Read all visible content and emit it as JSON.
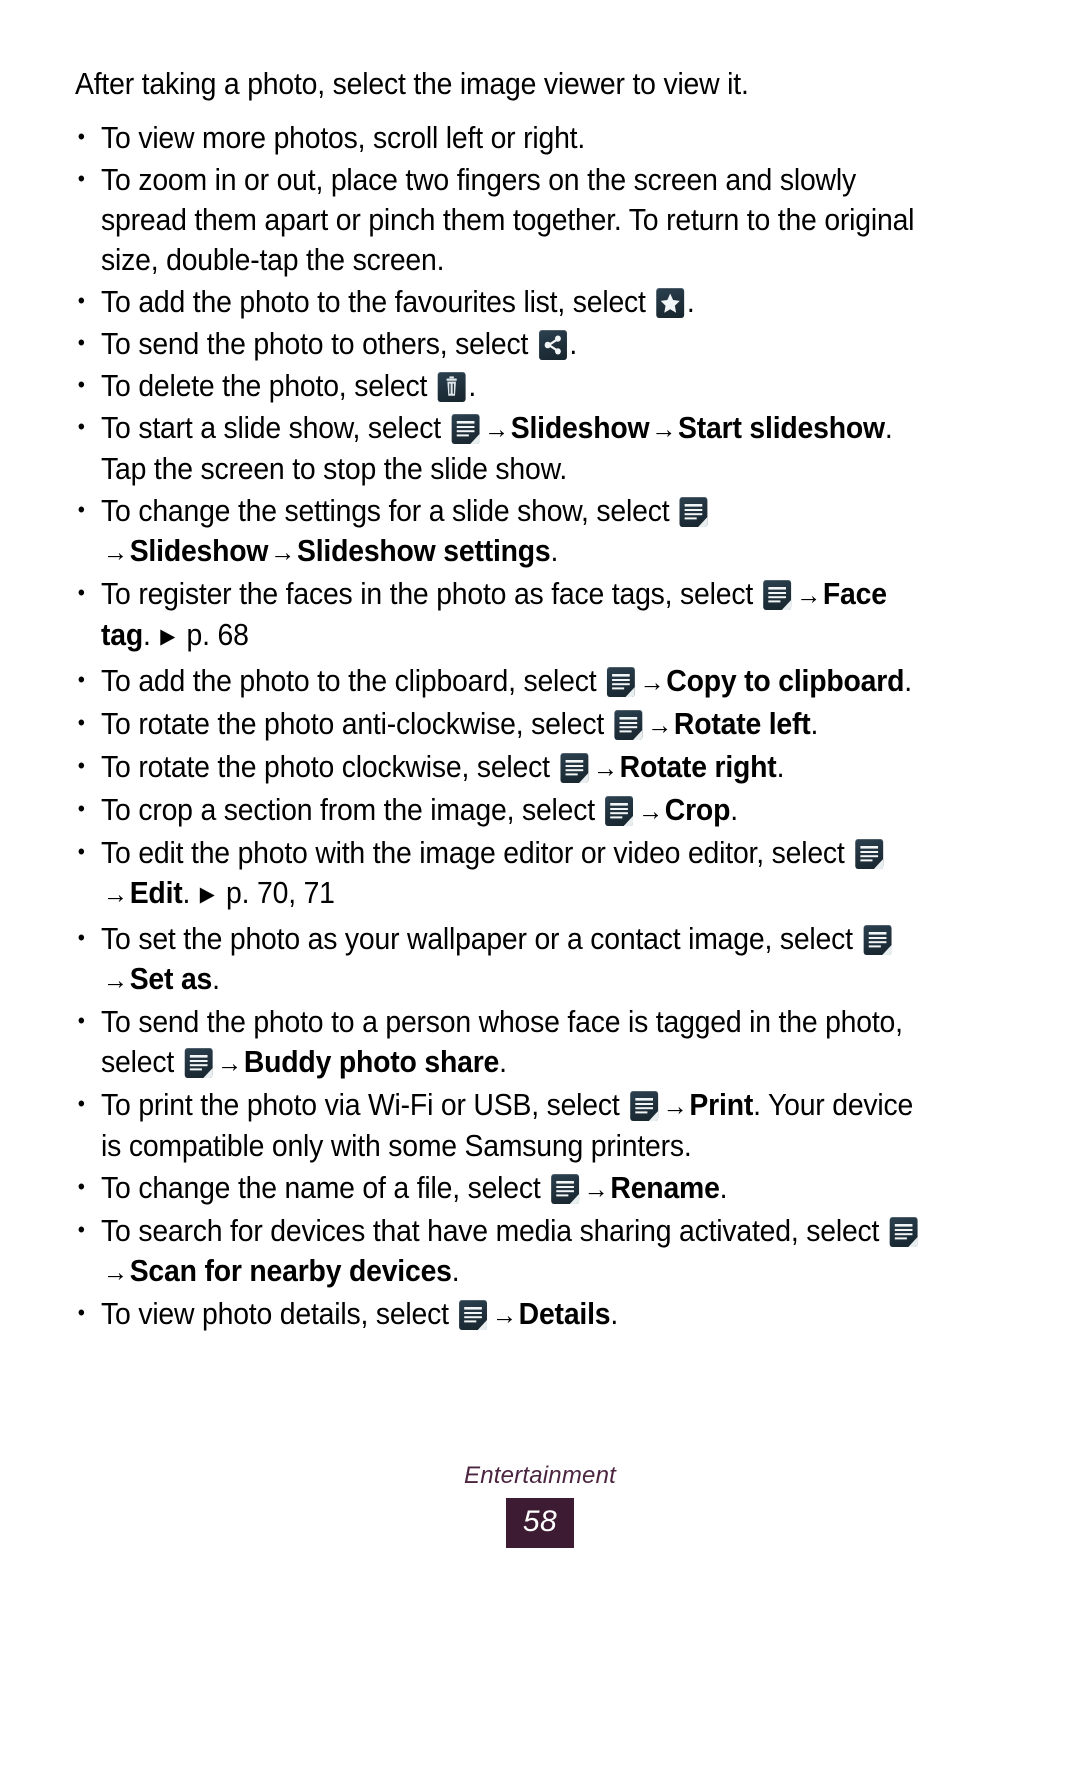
{
  "page": {
    "intro": "After taking a photo, select the image viewer to view it.",
    "footer_title": "Entertainment",
    "page_number": "58"
  },
  "icons": {
    "star": "star-icon",
    "share": "share-icon",
    "trash": "trash-icon",
    "menu": "menu-icon"
  },
  "symbols": {
    "arrow": "→",
    "pointer": "▶",
    "bullet": "•"
  },
  "bullets": [
    {
      "id": "scroll",
      "parts": [
        {
          "t": "text",
          "v": "To view more photos, scroll left or right."
        }
      ]
    },
    {
      "id": "zoom",
      "parts": [
        {
          "t": "text",
          "v": "To zoom in or out, place two fingers on the screen and slowly spread them apart or pinch them together. To return to the original size, double-tap the screen."
        }
      ]
    },
    {
      "id": "favourites",
      "parts": [
        {
          "t": "text",
          "v": "To add the photo to the favourites list, select "
        },
        {
          "t": "icon",
          "v": "star"
        },
        {
          "t": "text",
          "v": "."
        }
      ]
    },
    {
      "id": "send",
      "parts": [
        {
          "t": "text",
          "v": "To send the photo to others, select "
        },
        {
          "t": "icon",
          "v": "share"
        },
        {
          "t": "text",
          "v": "."
        }
      ]
    },
    {
      "id": "delete",
      "parts": [
        {
          "t": "text",
          "v": "To delete the photo, select "
        },
        {
          "t": "icon",
          "v": "trash"
        },
        {
          "t": "text",
          "v": "."
        }
      ]
    },
    {
      "id": "start-slideshow",
      "parts": [
        {
          "t": "text",
          "v": "To start a slide show, select "
        },
        {
          "t": "icon",
          "v": "menu"
        },
        {
          "t": "arrow"
        },
        {
          "t": "bold",
          "v": "Slideshow"
        },
        {
          "t": "arrow"
        },
        {
          "t": "bold",
          "v": "Start slideshow"
        },
        {
          "t": "text",
          "v": ". Tap the screen to stop the slide show."
        }
      ]
    },
    {
      "id": "slideshow-settings",
      "parts": [
        {
          "t": "text",
          "v": "To change the settings for a slide show, select "
        },
        {
          "t": "icon",
          "v": "menu"
        },
        {
          "t": "arrow"
        },
        {
          "t": "bold",
          "v": "Slideshow"
        },
        {
          "t": "arrow"
        },
        {
          "t": "bold",
          "v": "Slideshow settings"
        },
        {
          "t": "text",
          "v": "."
        }
      ]
    },
    {
      "id": "face-tag",
      "parts": [
        {
          "t": "text",
          "v": "To register the faces in the photo as face tags, select "
        },
        {
          "t": "icon",
          "v": "menu"
        },
        {
          "t": "arrow"
        },
        {
          "t": "bold",
          "v": "Face tag"
        },
        {
          "t": "text",
          "v": ". "
        },
        {
          "t": "pointer"
        },
        {
          "t": "text",
          "v": " p. 68"
        }
      ]
    },
    {
      "id": "copy-to-clipboard",
      "parts": [
        {
          "t": "text",
          "v": "To add the photo to the clipboard, select "
        },
        {
          "t": "icon",
          "v": "menu"
        },
        {
          "t": "arrow"
        },
        {
          "t": "bold",
          "v": "Copy to clipboard"
        },
        {
          "t": "text",
          "v": "."
        }
      ]
    },
    {
      "id": "rotate-left",
      "parts": [
        {
          "t": "text",
          "v": "To rotate the photo anti-clockwise, select "
        },
        {
          "t": "icon",
          "v": "menu"
        },
        {
          "t": "arrow"
        },
        {
          "t": "bold",
          "v": "Rotate left"
        },
        {
          "t": "text",
          "v": "."
        }
      ]
    },
    {
      "id": "rotate-right",
      "parts": [
        {
          "t": "text",
          "v": "To rotate the photo clockwise, select "
        },
        {
          "t": "icon",
          "v": "menu"
        },
        {
          "t": "arrow"
        },
        {
          "t": "bold",
          "v": "Rotate right"
        },
        {
          "t": "text",
          "v": "."
        }
      ]
    },
    {
      "id": "crop",
      "parts": [
        {
          "t": "text",
          "v": "To crop a section from the image, select "
        },
        {
          "t": "icon",
          "v": "menu"
        },
        {
          "t": "arrow"
        },
        {
          "t": "bold",
          "v": "Crop"
        },
        {
          "t": "text",
          "v": "."
        }
      ]
    },
    {
      "id": "edit",
      "parts": [
        {
          "t": "text",
          "v": "To edit the photo with the image editor or video editor, select "
        },
        {
          "t": "icon",
          "v": "menu"
        },
        {
          "t": "arrow"
        },
        {
          "t": "bold",
          "v": "Edit"
        },
        {
          "t": "text",
          "v": ". "
        },
        {
          "t": "pointer"
        },
        {
          "t": "text",
          "v": " p. 70, 71"
        }
      ]
    },
    {
      "id": "set-as",
      "parts": [
        {
          "t": "text",
          "v": "To set the photo as your wallpaper or a contact image, select "
        },
        {
          "t": "icon",
          "v": "menu"
        },
        {
          "t": "arrow"
        },
        {
          "t": "bold",
          "v": "Set as"
        },
        {
          "t": "text",
          "v": "."
        }
      ]
    },
    {
      "id": "buddy-photo-share",
      "parts": [
        {
          "t": "text",
          "v": "To send the photo to a person whose face is tagged in the photo, select "
        },
        {
          "t": "icon",
          "v": "menu"
        },
        {
          "t": "arrow"
        },
        {
          "t": "bold",
          "v": "Buddy photo share"
        },
        {
          "t": "text",
          "v": "."
        }
      ]
    },
    {
      "id": "print",
      "parts": [
        {
          "t": "text",
          "v": "To print the photo via Wi-Fi or USB, select "
        },
        {
          "t": "icon",
          "v": "menu"
        },
        {
          "t": "arrow"
        },
        {
          "t": "bold",
          "v": "Print"
        },
        {
          "t": "text",
          "v": ". Your device is compatible only with some Samsung printers."
        }
      ]
    },
    {
      "id": "rename",
      "parts": [
        {
          "t": "text",
          "v": "To change the name of a file, select "
        },
        {
          "t": "icon",
          "v": "menu"
        },
        {
          "t": "arrow"
        },
        {
          "t": "bold",
          "v": "Rename"
        },
        {
          "t": "text",
          "v": "."
        }
      ]
    },
    {
      "id": "scan-nearby",
      "parts": [
        {
          "t": "text",
          "v": "To search for devices that have media sharing activated, select "
        },
        {
          "t": "icon",
          "v": "menu"
        },
        {
          "t": "arrow"
        },
        {
          "t": "bold",
          "v": "Scan for nearby devices"
        },
        {
          "t": "text",
          "v": "."
        }
      ]
    },
    {
      "id": "details",
      "parts": [
        {
          "t": "text",
          "v": "To view photo details, select "
        },
        {
          "t": "icon",
          "v": "menu"
        },
        {
          "t": "arrow"
        },
        {
          "t": "bold",
          "v": "Details"
        },
        {
          "t": "text",
          "v": "."
        }
      ]
    }
  ]
}
